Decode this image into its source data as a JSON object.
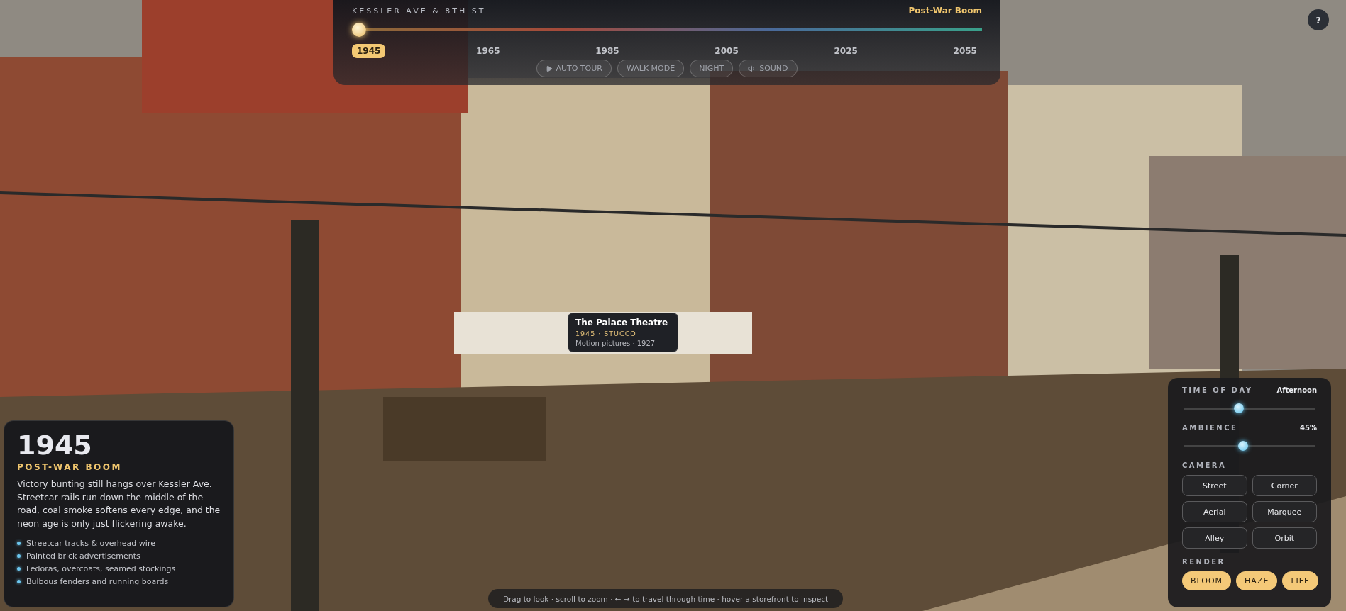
{
  "timeline": {
    "location": "KESSLER AVE & 8TH ST",
    "era": "Post-War Boom",
    "years": [
      {
        "label": "1945",
        "selected": true
      },
      {
        "label": "1965",
        "selected": false
      },
      {
        "label": "1985",
        "selected": false
      },
      {
        "label": "2005",
        "selected": false
      },
      {
        "label": "2025",
        "selected": false
      },
      {
        "label": "2055",
        "selected": false
      }
    ],
    "buttons": [
      {
        "label": "AUTO TOUR",
        "kind": "play"
      },
      {
        "label": "WALK MODE",
        "kind": "plain"
      },
      {
        "label": "NIGHT",
        "kind": "plain"
      },
      {
        "label": "SOUND",
        "kind": "sound"
      }
    ]
  },
  "help": {
    "label": "?"
  },
  "era_card": {
    "year": "1945",
    "era": "POST-WAR BOOM",
    "description": "Victory bunting still hangs over Kessler Ave. Streetcar rails run down the middle of the road, coal smoke softens every edge, and the neon age is only just flickering awake.",
    "features": [
      "Streetcar tracks & overhead wire",
      "Painted brick advertisements",
      "Fedoras, overcoats, seamed stockings",
      "Bulbous fenders and running boards"
    ]
  },
  "tooltip": {
    "title": "The Palace Theatre",
    "meta": "1945 · STUCCO",
    "detail": "Motion pictures · 1927"
  },
  "controls": {
    "sliders": [
      {
        "label": "TIME OF DAY",
        "reading": "Afternoon",
        "level": 0.41
      },
      {
        "label": "AMBIENCE",
        "reading": "45%",
        "level": 0.45
      }
    ],
    "camera_label": "CAMERA",
    "cameras": [
      "Street",
      "Corner",
      "Aerial",
      "Marquee",
      "Alley",
      "Orbit"
    ],
    "render_label": "RENDER",
    "render": [
      {
        "label": "BLOOM",
        "on": true
      },
      {
        "label": "HAZE",
        "on": true
      },
      {
        "label": "LIFE",
        "on": true
      }
    ]
  },
  "hint": "Drag to look · scroll to zoom · ← → to travel through time · hover a storefront to inspect"
}
